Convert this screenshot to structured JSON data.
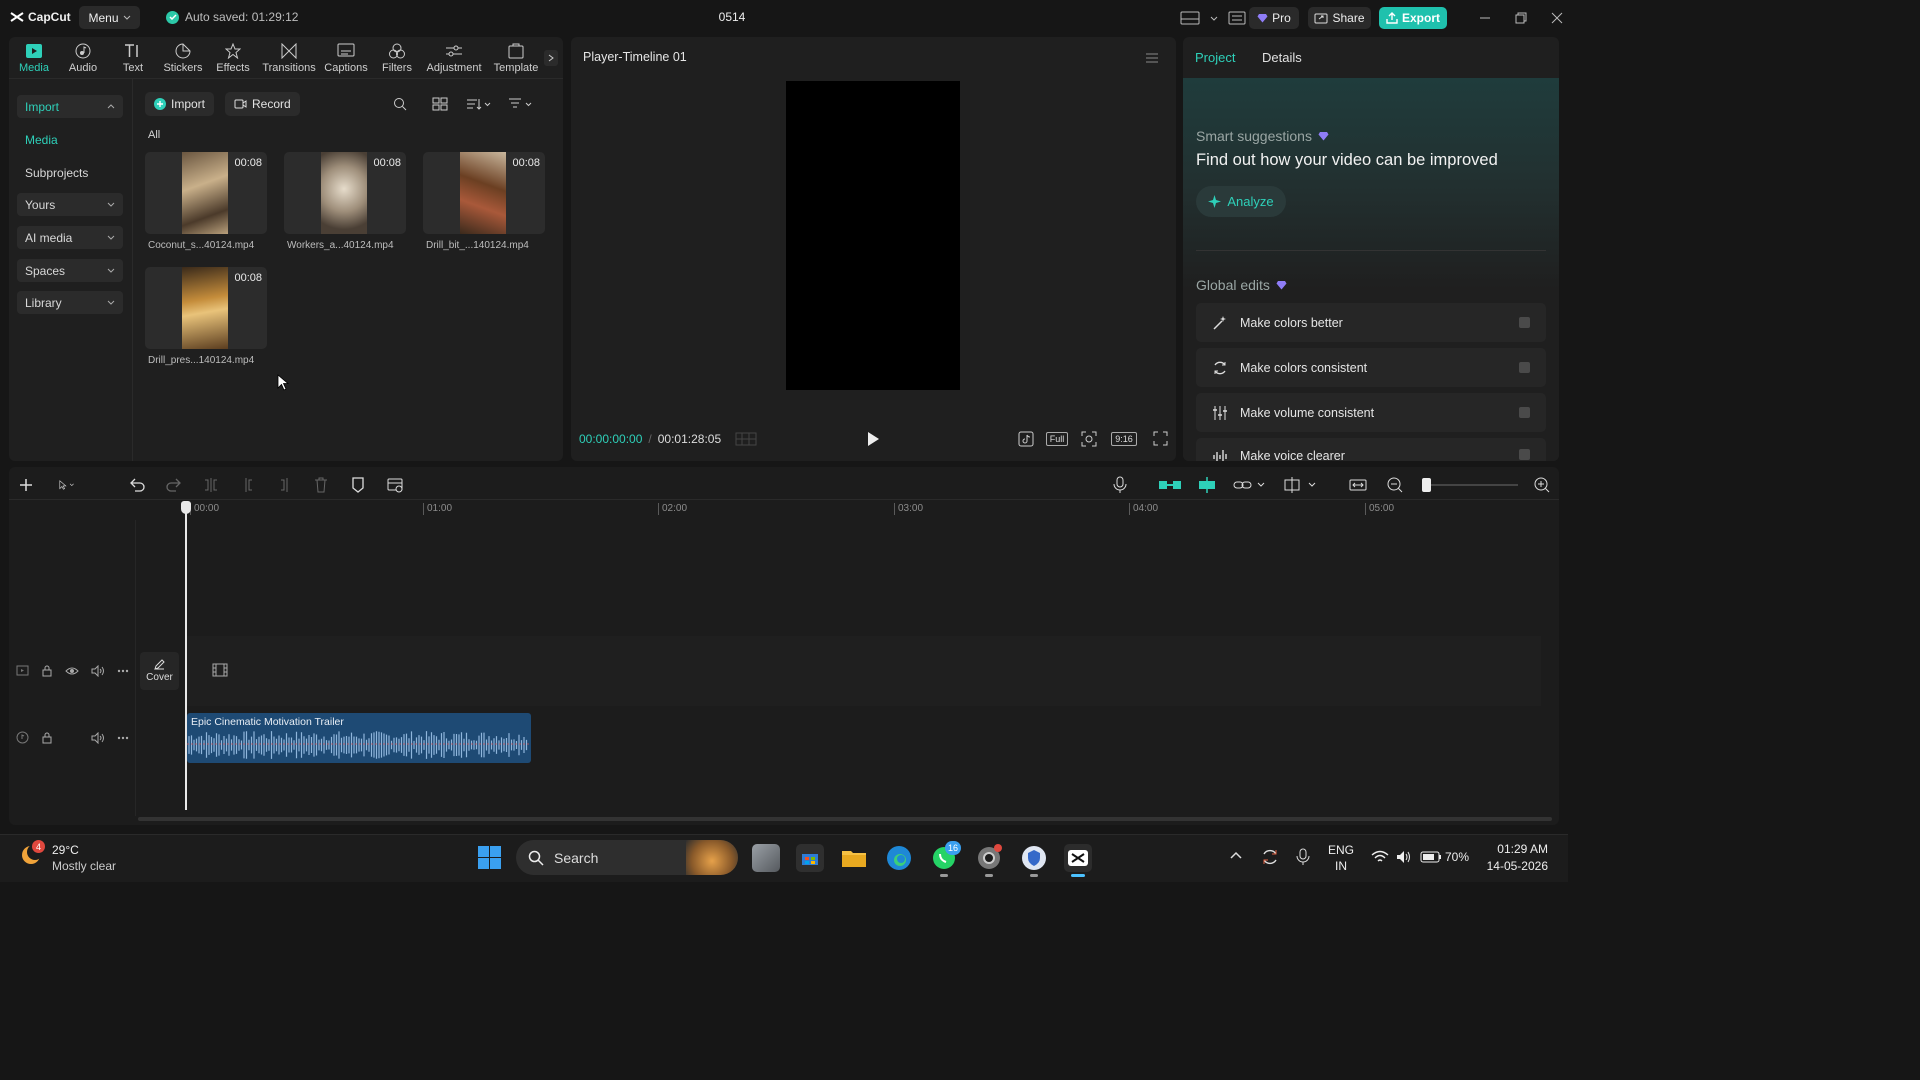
{
  "app": {
    "logo_text": "CapCut",
    "menu_label": "Menu",
    "autosave_text": "Auto saved: 01:29:12",
    "project_name": "0514",
    "pro_label": "Pro",
    "share_label": "Share",
    "export_label": "Export"
  },
  "toolbar": {
    "items": [
      {
        "label": "Media",
        "icon": "media-icon",
        "active": true
      },
      {
        "label": "Audio",
        "icon": "audio-icon"
      },
      {
        "label": "Text",
        "icon": "text-icon"
      },
      {
        "label": "Stickers",
        "icon": "stickers-icon"
      },
      {
        "label": "Effects",
        "icon": "effects-icon"
      },
      {
        "label": "Transitions",
        "icon": "transitions-icon"
      },
      {
        "label": "Captions",
        "icon": "captions-icon"
      },
      {
        "label": "Filters",
        "icon": "filters-icon"
      },
      {
        "label": "Adjustment",
        "icon": "adjustment-icon"
      },
      {
        "label": "Template",
        "icon": "template-icon"
      }
    ]
  },
  "sidebar": {
    "items": [
      {
        "label": "Import",
        "type": "section-open"
      },
      {
        "label": "Media",
        "type": "active"
      },
      {
        "label": "Subprojects",
        "type": "plain"
      },
      {
        "label": "Yours",
        "type": "dropdown"
      },
      {
        "label": "AI media",
        "type": "dropdown"
      },
      {
        "label": "Spaces",
        "type": "dropdown"
      },
      {
        "label": "Library",
        "type": "dropdown"
      }
    ]
  },
  "media": {
    "import_label": "Import",
    "record_label": "Record",
    "filter_label": "All",
    "clips": [
      {
        "name": "Coconut_s...40124.mp4",
        "duration": "00:08"
      },
      {
        "name": "Workers_a...40124.mp4",
        "duration": "00:08"
      },
      {
        "name": "Drill_bit_...140124.mp4",
        "duration": "00:08"
      },
      {
        "name": "Drill_pres...140124.mp4",
        "duration": "00:08"
      }
    ]
  },
  "player": {
    "title": "Player-Timeline 01",
    "current_time": "00:00:00:00",
    "total_time": "00:01:28:05",
    "full_label": "Full",
    "ratio_label": "9:16"
  },
  "right_panel": {
    "tabs": [
      "Project",
      "Details"
    ],
    "smart_title": "Smart suggestions",
    "smart_subtitle": "Find out how your video can be improved",
    "analyze_label": "Analyze",
    "global_title": "Global edits",
    "edits": [
      {
        "label": "Make colors better",
        "icon": "magic-wand-icon"
      },
      {
        "label": "Make colors consistent",
        "icon": "color-sync-icon"
      },
      {
        "label": "Make volume consistent",
        "icon": "sliders-icon"
      },
      {
        "label": "Make voice clearer",
        "icon": "voice-wave-icon"
      }
    ]
  },
  "timeline": {
    "ticks": [
      "00:00",
      "01:00",
      "02:00",
      "03:00",
      "04:00",
      "05:00"
    ],
    "cover_label": "Cover",
    "audio_clip_label": "Epic Cinematic Motivation Trailer"
  },
  "taskbar": {
    "temperature": "29°C",
    "weather": "Mostly clear",
    "weather_badge": "4",
    "search_label": "Search",
    "whatsapp_badge": "16",
    "lang": "ENG",
    "region": "IN",
    "battery": "70%",
    "time": "01:29 AM",
    "date": "14-05-2026"
  },
  "colors": {
    "accent": "#2ed0b9",
    "export_bg": "#1fc1ad",
    "audio_clip": "#1e4a74",
    "pro_gem": "#8f7df7"
  }
}
